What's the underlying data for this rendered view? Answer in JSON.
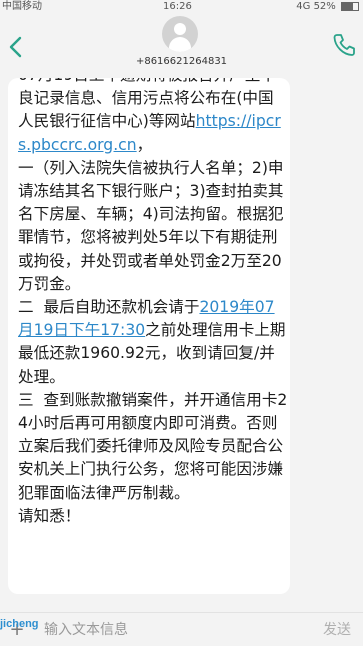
{
  "status_bar": {
    "carrier": "中国移动",
    "time": "16:26",
    "right": "4G 52%",
    "icons": [
      "notification-icon",
      "signal-icon",
      "battery-icon"
    ]
  },
  "header": {
    "phone_number": "+8616621264831",
    "back_icon": "chevron-left-icon",
    "call_icon": "phone-icon",
    "accent_color": "#2aa38a"
  },
  "message": {
    "intro": "良记录信息、信用污点将公布在(中国人民银行征信中心)等网站",
    "link": "https://ipcrs.pbccrc.org.cn",
    "after_link": "，",
    "p1": "一（列入法院失信被执行人名单；2)申请冻结其名下银行账户；3)查封拍卖其名下房屋、车辆；4)司法拘留。根据犯罪情节，您将被判处5年以下有期徒刑或拘役，并处罚或者单处罚金2万至20万罚金。",
    "p2_pre": "二  最后自助还款机会请于",
    "date_link": "2019年07月19日下午17:30",
    "p2_post": "之前处理信用卡上期最低还款1960.92元，收到请回复/并处理。",
    "p3": "三  查到账款撤销案件，并开通信用卡24小时后再可用额度内即可消费。否则立案后我们委托律师及风险专员配合公安机关上门执行公务，您将可能因涉嫌犯罪面临法律严厉制裁。",
    "closing": "请知悉！"
  },
  "composer": {
    "placeholder": "输入文本信息",
    "send_label": "发送",
    "attach_icon": "add-icon"
  },
  "watermark": "jicheng"
}
